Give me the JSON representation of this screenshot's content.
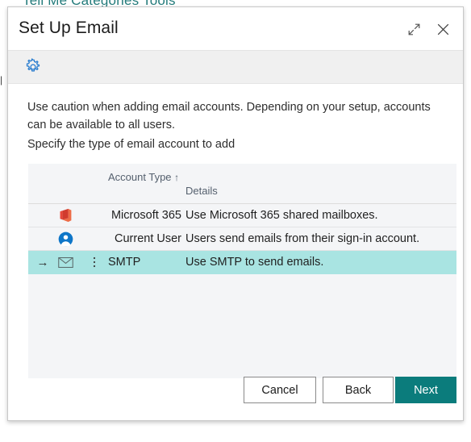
{
  "backdrop": {
    "page_title": "Tell Me Categories Tools",
    "left_edge_text": "|"
  },
  "dialog": {
    "title": "Set Up Email",
    "expand_icon": "expand-icon",
    "close_icon": "close-icon"
  },
  "toolbar": {
    "settings_icon": "gear-icon",
    "settings_label": "Settings"
  },
  "content": {
    "caution_text": "Use caution when adding email accounts. Depending on your setup, accounts can be available to all users.",
    "instruction_text": "Specify the type of email account to add"
  },
  "table": {
    "columns": [
      {
        "key": "account_type",
        "label": "Account Type",
        "sort": "↑"
      },
      {
        "key": "details",
        "label": "Details"
      }
    ],
    "rows": [
      {
        "icon": "office-365-icon",
        "account_type": "Microsoft 365",
        "details": "Use Microsoft 365 shared mailboxes.",
        "selected": false
      },
      {
        "icon": "user-circle-icon",
        "account_type": "Current User",
        "details": "Users send emails from their sign-in account.",
        "selected": false
      },
      {
        "icon": "envelope-icon",
        "account_type": "SMTP",
        "details": "Use SMTP to send emails.",
        "selected": true,
        "row_arrow": "→",
        "row_menu_icon": "more-vertical-icon"
      }
    ]
  },
  "footer": {
    "cancel_label": "Cancel",
    "back_label": "Back",
    "next_label": "Next"
  },
  "colors": {
    "accent_teal": "#0b7c7c",
    "selected_row": "#a9e4e2",
    "table_bg": "#f4f5f7",
    "toolbar_bg": "#f0f0f0",
    "gear_blue": "#2f80d0",
    "office_red": "#d83b01",
    "user_blue": "#0078d4",
    "backdrop_title": "#237b7b"
  }
}
